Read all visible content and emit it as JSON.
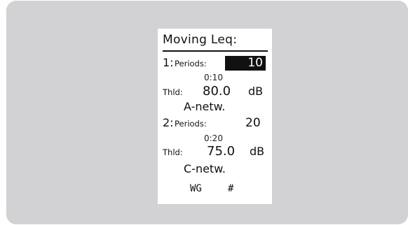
{
  "display": {
    "title": "Moving Leq:",
    "channels": [
      {
        "index": "1:",
        "periods_label": "Periods:",
        "periods_value": "10",
        "time": "0:10",
        "threshold_label": "Thld:",
        "threshold_value": "80.0",
        "threshold_unit": "dB",
        "network": "A-netw."
      },
      {
        "index": "2:",
        "periods_label": "Periods:",
        "periods_value": "20",
        "time": "0:20",
        "threshold_label": "Thld:",
        "threshold_value": "75.0",
        "threshold_unit": "dB",
        "network": "C-netw."
      }
    ],
    "footer": {
      "left": "WG",
      "right": "#"
    }
  }
}
